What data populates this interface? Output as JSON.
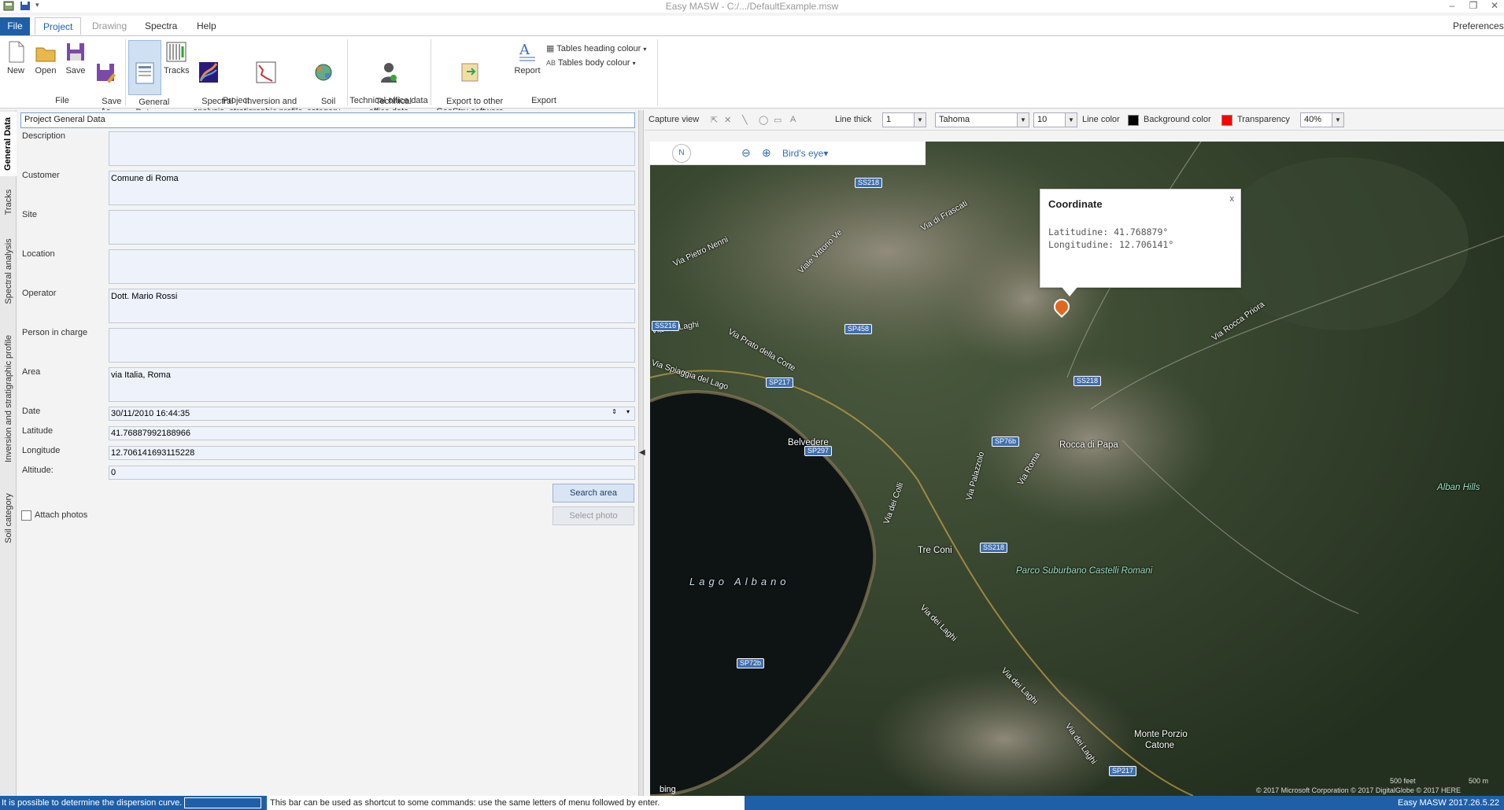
{
  "app": {
    "title": "Easy MASW - C:/.../DefaultExample.msw",
    "preferences": "Preferences"
  },
  "tabs": [
    {
      "label": "File"
    },
    {
      "label": "Project"
    },
    {
      "label": "Drawing"
    },
    {
      "label": "Spectra"
    },
    {
      "label": "Help"
    }
  ],
  "ribbon": {
    "file_group": {
      "label": "File",
      "buttons": [
        {
          "label": "New",
          "icon": "new-document-icon"
        },
        {
          "label": "Open",
          "icon": "open-folder-icon"
        },
        {
          "label": "Save",
          "icon": "save-icon"
        },
        {
          "label": "Save\nAs",
          "icon": "save-as-icon"
        }
      ]
    },
    "project_group": {
      "label": "Project",
      "buttons": [
        {
          "label": "General\nData",
          "icon": "general-data-icon",
          "selected": true
        },
        {
          "label": "Tracks",
          "icon": "tracks-icon"
        },
        {
          "label": "Spectral\nanalysis",
          "icon": "spectral-analysis-icon"
        },
        {
          "label": "Inversion and\nstratigraphic profile",
          "icon": "inversion-profile-icon"
        },
        {
          "label": "Soil\ncategory",
          "icon": "soil-category-icon"
        }
      ]
    },
    "technical_group": {
      "label": "Technical office data",
      "buttons": [
        {
          "label": "Technical\noffice data",
          "icon": "technical-office-icon"
        }
      ]
    },
    "export_group": {
      "label": "Export",
      "buttons": [
        {
          "label": "Export to other\nGeoStru software",
          "icon": "export-icon"
        },
        {
          "label": "Report",
          "icon": "report-icon"
        }
      ],
      "tables_heading": "Tables heading colour",
      "tables_body": "Tables body colour"
    }
  },
  "vtabs": [
    {
      "label": "General Data",
      "active": true
    },
    {
      "label": "Tracks"
    },
    {
      "label": "Spectral analysis"
    },
    {
      "label": "Inversion and stratigraphic profile"
    },
    {
      "label": "Soil category"
    }
  ],
  "form": {
    "header": "Project General Data",
    "description": {
      "label": "Description",
      "value": ""
    },
    "customer": {
      "label": "Customer",
      "value": "Comune di Roma"
    },
    "site": {
      "label": "Site",
      "value": ""
    },
    "location": {
      "label": "Location",
      "value": ""
    },
    "operator": {
      "label": "Operator",
      "value": "Dott. Mario Rossi"
    },
    "person_in_charge": {
      "label": "Person in charge",
      "value": ""
    },
    "area": {
      "label": "Area",
      "value": "via Italia, Roma"
    },
    "date": {
      "label": "Date",
      "value": "30/11/2010 16:44:35"
    },
    "latitude": {
      "label": "Latitude",
      "value": "41.76887992188966"
    },
    "longitude": {
      "label": "Longitude",
      "value": "12.706141693115228"
    },
    "altitude": {
      "label": "Altitude:",
      "value": "0"
    },
    "search_area": "Search area",
    "select_photo": "Select photo",
    "attach_photos": "Attach photos"
  },
  "map_toolbar": {
    "capture_view": "Capture view",
    "line_thick_label": "Line thick",
    "line_thick_value": "1",
    "font_value": "Tahoma",
    "font_size": "10",
    "line_color_label": "Line color",
    "line_color": "#000000",
    "bg_color_label": "Background color",
    "bg_color": "#ff0000",
    "transparency_label": "Transparency",
    "transparency_value": "40%"
  },
  "map": {
    "nav_n": "N",
    "birds_eye": "Bird's eye",
    "popup": {
      "title": "Coordinate",
      "close": "x",
      "lat": "Latitudine: 41.768879°",
      "lon": "Longitudine: 12.706141°"
    },
    "places": {
      "rocca": "Rocca di Papa",
      "belvedere": "Belvedere",
      "treconi": "Tre Coni",
      "lago": "Lago Albano",
      "parco": "Parco Suburbano Castelli Romani",
      "monte1": "Monte Porzio",
      "monte2": "Catone",
      "alban": "Alban Hills"
    },
    "roads": {
      "vittorio": "Viale Vittorio Ve",
      "frascati": "Via di Frascati",
      "pietro": "Via Pietro Nenni",
      "prato": "Via Prato della Corte",
      "laghi1": "Via dei Laghi",
      "spiaggia": "Via Spiaggia del Lago",
      "rocca_priora": "Via Rocca Priora",
      "laghi2": "Via dei Laghi",
      "laghi3": "Via dei Laghi",
      "laghi4": "Via dei Laghi",
      "colli": "Via dei Colli",
      "roma": "Via Roma",
      "palazzolo": "Via Palazzolo"
    },
    "shields": [
      "SS218",
      "SS216",
      "SP458",
      "SP217",
      "SS218",
      "SP297",
      "SP76b",
      "SS218",
      "SP72b",
      "SP217"
    ],
    "attribution": "© 2017 Microsoft Corporation   © 2017 DigitalGlobe   © 2017 HERE",
    "scale1": "500 feet",
    "scale2": "500 m",
    "bing": "bing"
  },
  "status": {
    "left": "It is possible to determine the dispersion curve.",
    "hint": "This bar can be used as shortcut to some commands: use the same letters of menu followed by enter.",
    "version": "Easy MASW 2017.26.5.22"
  }
}
